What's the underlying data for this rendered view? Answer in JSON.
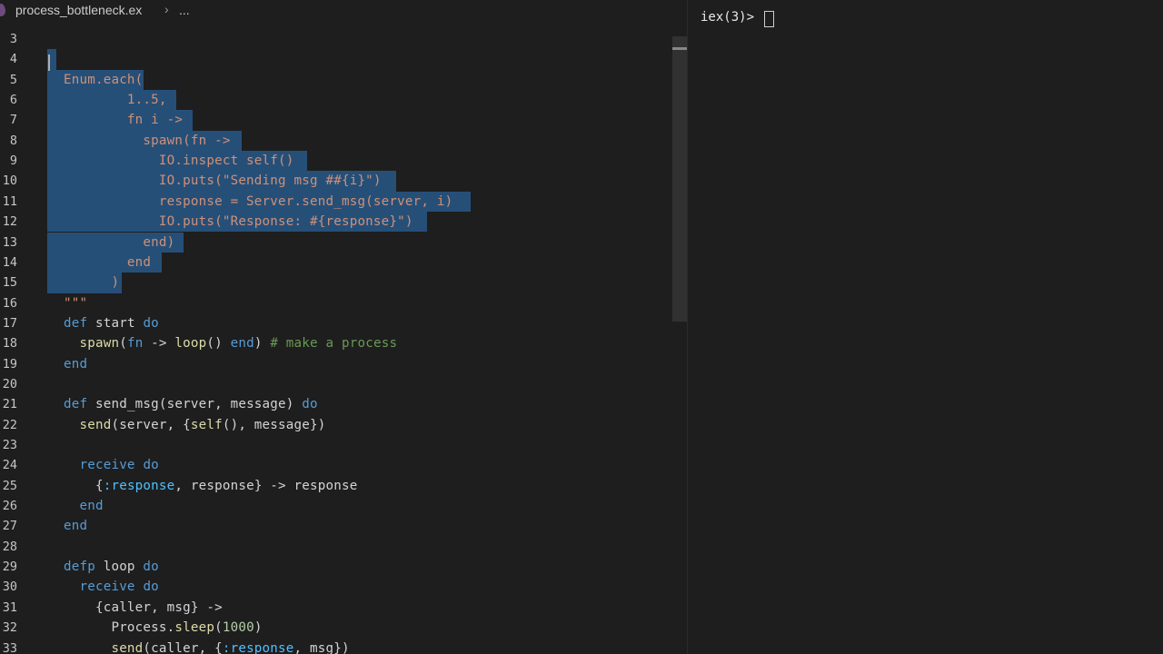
{
  "breadcrumb": {
    "file": "process_bottleneck.ex",
    "separator": "›",
    "more": "..."
  },
  "terminal": {
    "prompt": "iex(3)>"
  },
  "lines": [
    {
      "n": "3",
      "tokens": [
        {
          "t": "      ",
          "c": ""
        }
      ],
      "sel": false
    },
    {
      "n": "4",
      "tokens": [
        {
          "t": "",
          "c": ""
        }
      ],
      "sel": true
    },
    {
      "n": "5",
      "tokens": [
        {
          "t": "Enum.each(",
          "c": "st"
        }
      ],
      "sel": true
    },
    {
      "n": "6",
      "tokens": [
        {
          "t": "        1..5,",
          "c": "st"
        }
      ],
      "sel": true
    },
    {
      "n": "7",
      "tokens": [
        {
          "t": "        fn i ->",
          "c": "st"
        }
      ],
      "sel": true
    },
    {
      "n": "8",
      "tokens": [
        {
          "t": "          spawn(fn ->",
          "c": "st"
        }
      ],
      "sel": true
    },
    {
      "n": "9",
      "tokens": [
        {
          "t": "            IO.inspect self()",
          "c": "st"
        }
      ],
      "sel": true
    },
    {
      "n": "10",
      "tokens": [
        {
          "t": "            IO.puts(\"Sending msg ##{i}\")",
          "c": "st"
        }
      ],
      "sel": true
    },
    {
      "n": "11",
      "tokens": [
        {
          "t": "            response = Server.send_msg(server, i)",
          "c": "st"
        }
      ],
      "sel": true
    },
    {
      "n": "12",
      "tokens": [
        {
          "t": "            IO.puts(\"Response: #{response}\")",
          "c": "st"
        }
      ],
      "sel": true
    },
    {
      "n": "13",
      "tokens": [
        {
          "t": "          end)",
          "c": "st"
        }
      ],
      "sel": true
    },
    {
      "n": "14",
      "tokens": [
        {
          "t": "        end",
          "c": "st"
        }
      ],
      "sel": true
    },
    {
      "n": "15",
      "tokens": [
        {
          "t": "      )",
          "c": "st"
        }
      ],
      "sel": true
    },
    {
      "n": "16",
      "tokens": [
        {
          "t": "\"\"\"",
          "c": "st"
        }
      ],
      "sel": false
    },
    {
      "n": "17",
      "tokens": [
        {
          "t": "def",
          "c": "kw"
        },
        {
          "t": " start ",
          "c": ""
        },
        {
          "t": "do",
          "c": "kw"
        }
      ],
      "sel": false
    },
    {
      "n": "18",
      "tokens": [
        {
          "t": "  ",
          "c": ""
        },
        {
          "t": "spawn",
          "c": "fn"
        },
        {
          "t": "(",
          "c": ""
        },
        {
          "t": "fn",
          "c": "kw"
        },
        {
          "t": " -> ",
          "c": ""
        },
        {
          "t": "loop",
          "c": "fn"
        },
        {
          "t": "() ",
          "c": ""
        },
        {
          "t": "end",
          "c": "kw"
        },
        {
          "t": ") ",
          "c": ""
        },
        {
          "t": "# make a process",
          "c": "cm"
        }
      ],
      "sel": false
    },
    {
      "n": "19",
      "tokens": [
        {
          "t": "end",
          "c": "kw"
        }
      ],
      "sel": false
    },
    {
      "n": "20",
      "tokens": [
        {
          "t": "",
          "c": ""
        }
      ],
      "sel": false
    },
    {
      "n": "21",
      "tokens": [
        {
          "t": "def",
          "c": "kw"
        },
        {
          "t": " send_msg(server, message) ",
          "c": ""
        },
        {
          "t": "do",
          "c": "kw"
        }
      ],
      "sel": false
    },
    {
      "n": "22",
      "tokens": [
        {
          "t": "  ",
          "c": ""
        },
        {
          "t": "send",
          "c": "fn"
        },
        {
          "t": "(server, {",
          "c": ""
        },
        {
          "t": "self",
          "c": "fn"
        },
        {
          "t": "(), message})",
          "c": ""
        }
      ],
      "sel": false
    },
    {
      "n": "23",
      "tokens": [
        {
          "t": "",
          "c": ""
        }
      ],
      "sel": false
    },
    {
      "n": "24",
      "tokens": [
        {
          "t": "  ",
          "c": ""
        },
        {
          "t": "receive",
          "c": "kw"
        },
        {
          "t": " ",
          "c": ""
        },
        {
          "t": "do",
          "c": "kw"
        }
      ],
      "sel": false
    },
    {
      "n": "25",
      "tokens": [
        {
          "t": "    {",
          "c": ""
        },
        {
          "t": ":response",
          "c": "at"
        },
        {
          "t": ", response} -> response",
          "c": ""
        }
      ],
      "sel": false
    },
    {
      "n": "26",
      "tokens": [
        {
          "t": "  ",
          "c": ""
        },
        {
          "t": "end",
          "c": "kw"
        }
      ],
      "sel": false
    },
    {
      "n": "27",
      "tokens": [
        {
          "t": "end",
          "c": "kw"
        }
      ],
      "sel": false
    },
    {
      "n": "28",
      "tokens": [
        {
          "t": "",
          "c": ""
        }
      ],
      "sel": false
    },
    {
      "n": "29",
      "tokens": [
        {
          "t": "defp",
          "c": "kw"
        },
        {
          "t": " loop ",
          "c": ""
        },
        {
          "t": "do",
          "c": "kw"
        }
      ],
      "sel": false
    },
    {
      "n": "30",
      "tokens": [
        {
          "t": "  ",
          "c": ""
        },
        {
          "t": "receive",
          "c": "kw"
        },
        {
          "t": " ",
          "c": ""
        },
        {
          "t": "do",
          "c": "kw"
        }
      ],
      "sel": false
    },
    {
      "n": "31",
      "tokens": [
        {
          "t": "    {caller, msg} ->",
          "c": ""
        }
      ],
      "sel": false
    },
    {
      "n": "32",
      "tokens": [
        {
          "t": "      Process.",
          "c": ""
        },
        {
          "t": "sleep",
          "c": "fn"
        },
        {
          "t": "(",
          "c": ""
        },
        {
          "t": "1000",
          "c": "nm"
        },
        {
          "t": ")",
          "c": ""
        }
      ],
      "sel": false
    },
    {
      "n": "33",
      "tokens": [
        {
          "t": "      ",
          "c": ""
        },
        {
          "t": "send",
          "c": "fn"
        },
        {
          "t": "(caller, {",
          "c": ""
        },
        {
          "t": ":response",
          "c": "at"
        },
        {
          "t": ", msg})",
          "c": ""
        }
      ],
      "sel": false
    }
  ]
}
